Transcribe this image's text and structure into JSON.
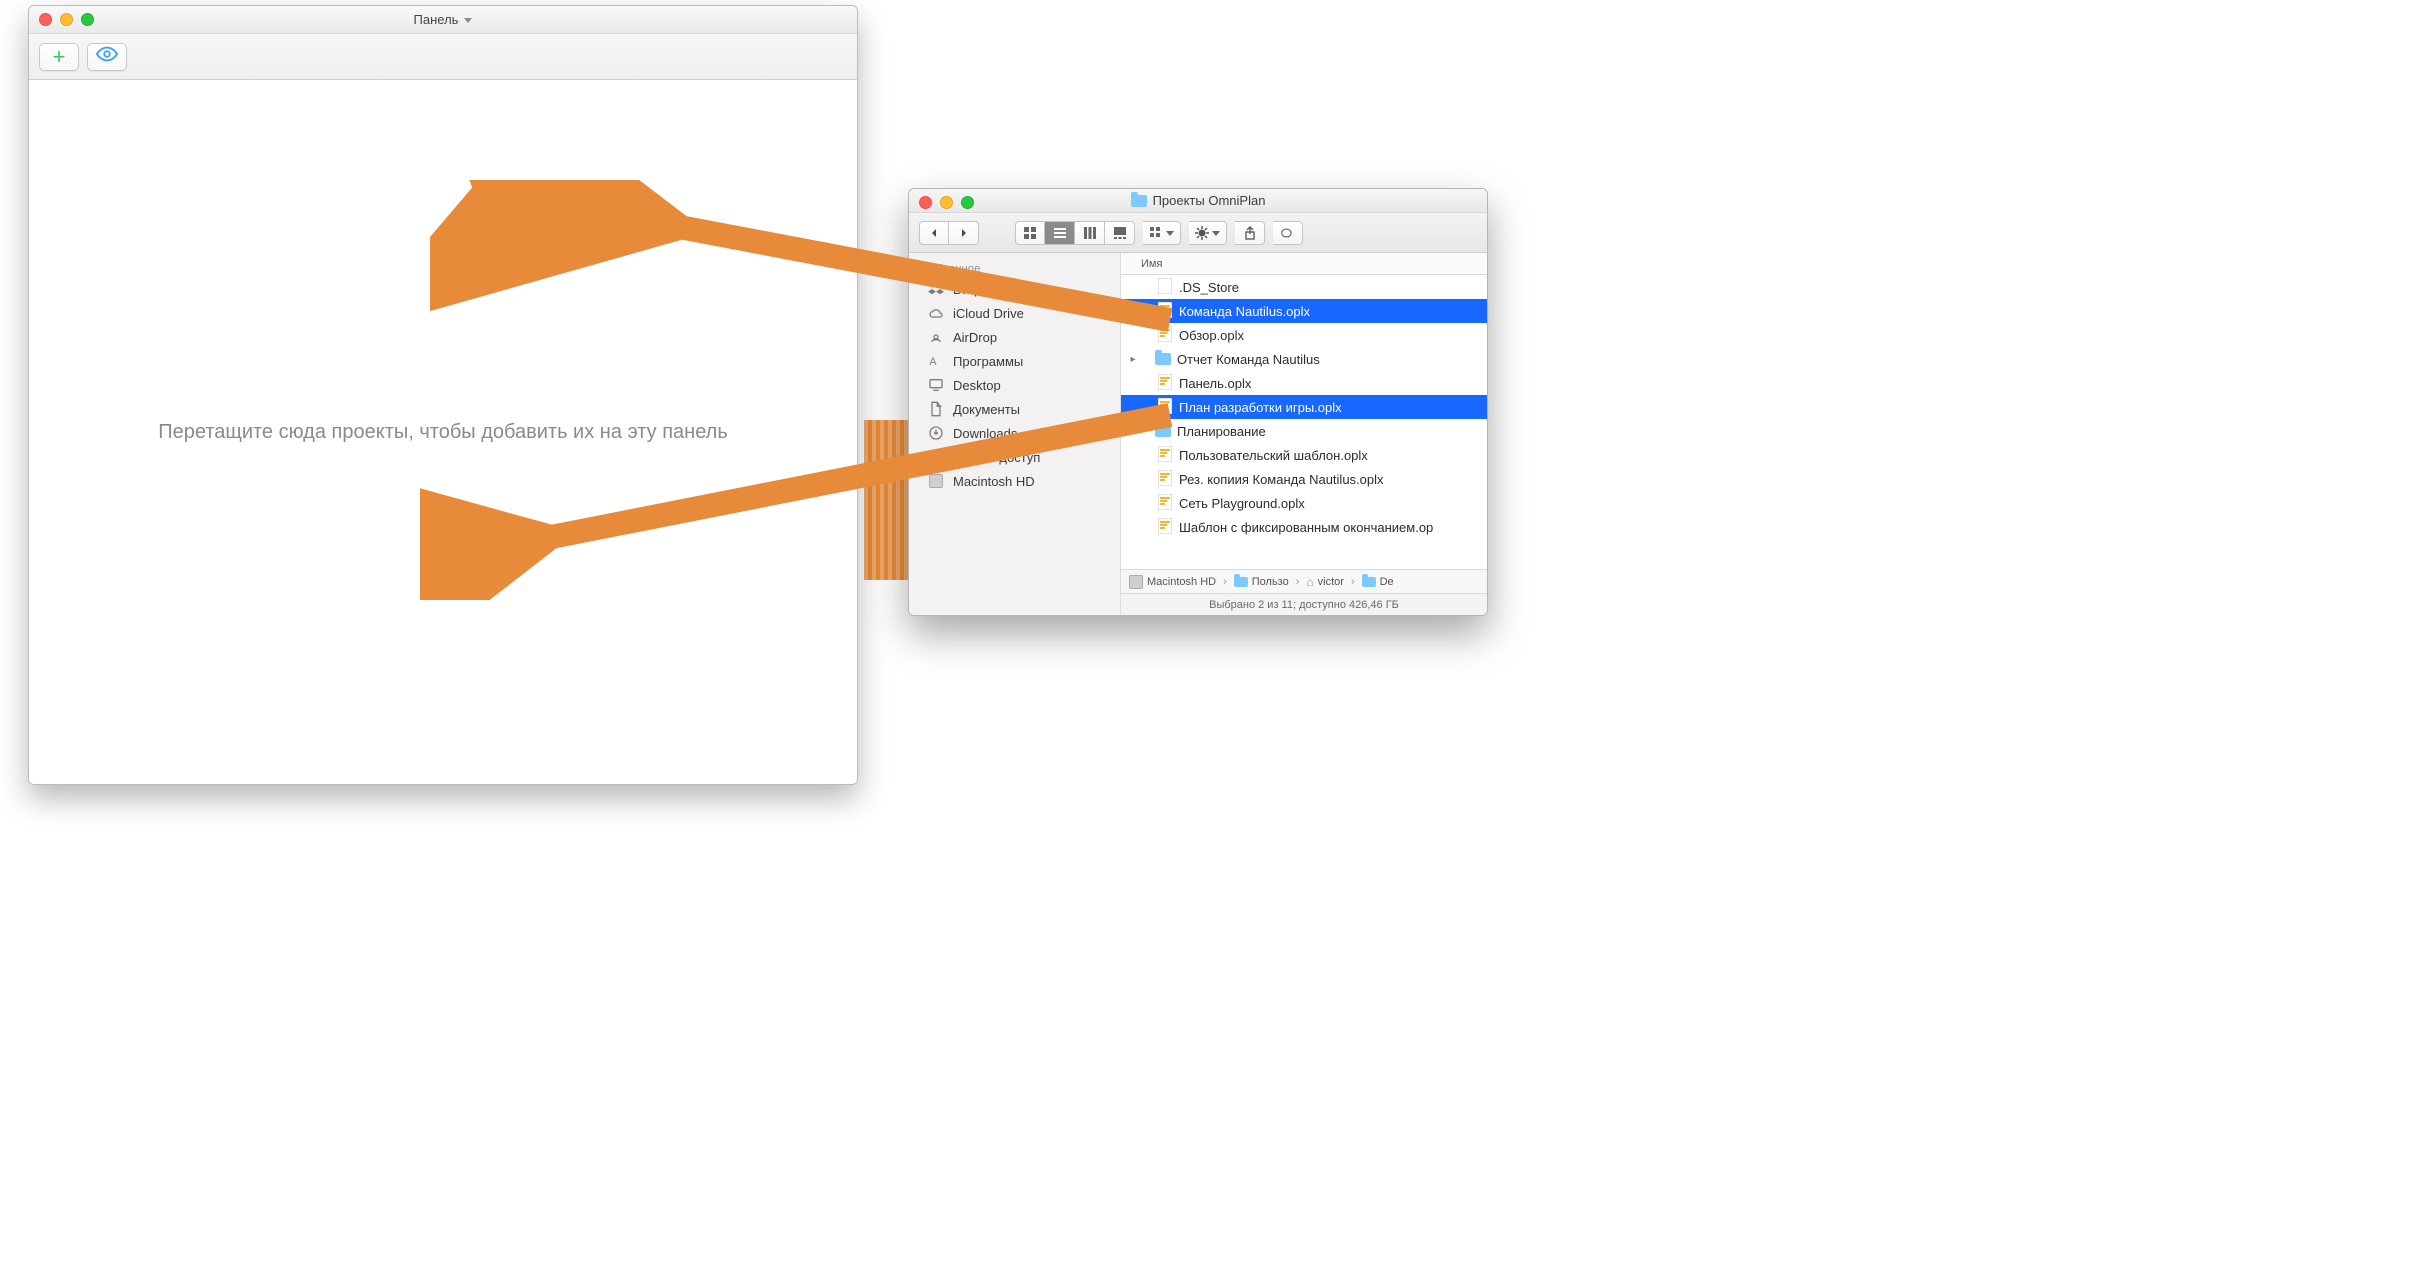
{
  "panel": {
    "title": "Панель",
    "drop_message": "Перетащите сюда проекты, чтобы добавить их на эту панель"
  },
  "finder": {
    "title": "Проекты OmniPlan",
    "sidebar": {
      "section": "Избранное",
      "items": [
        {
          "label": "Dropbox",
          "icon": "dropbox"
        },
        {
          "label": "iCloud Drive",
          "icon": "cloud"
        },
        {
          "label": "AirDrop",
          "icon": "airdrop"
        },
        {
          "label": "Программы",
          "icon": "apps"
        },
        {
          "label": "Desktop",
          "icon": "desktop"
        },
        {
          "label": "Документы",
          "icon": "documents"
        },
        {
          "label": "Downloads",
          "icon": "downloads"
        },
        {
          "label": "Общий доступ",
          "icon": "shared"
        },
        {
          "label": "Macintosh HD",
          "icon": "hd"
        }
      ]
    },
    "column_header": "Имя",
    "files": [
      {
        "name": ".DS_Store",
        "type": "file-generic",
        "selected": false,
        "indent": 1
      },
      {
        "name": "Команда Nautilus.oplx",
        "type": "oplx",
        "selected": true,
        "indent": 1
      },
      {
        "name": "Обзор.oplx",
        "type": "oplx",
        "selected": false,
        "indent": 1
      },
      {
        "name": "Отчет Команда Nautilus",
        "type": "folder",
        "selected": false,
        "indent": 0,
        "disclosure": true
      },
      {
        "name": "Панель.oplx",
        "type": "oplx",
        "selected": false,
        "indent": 1
      },
      {
        "name": "План разработки игры.oplx",
        "type": "oplx",
        "selected": true,
        "indent": 1
      },
      {
        "name": "Планирование",
        "type": "folder",
        "selected": false,
        "indent": 0,
        "disclosure": true
      },
      {
        "name": "Пользовательский шаблон.oplx",
        "type": "oplx",
        "selected": false,
        "indent": 1
      },
      {
        "name": "Рез. копиия Команда Nautilus.oplx",
        "type": "oplx",
        "selected": false,
        "indent": 1
      },
      {
        "name": "Сеть Playground.oplx",
        "type": "oplx",
        "selected": false,
        "indent": 1
      },
      {
        "name": "Шаблон с фиксированным окончанием.op",
        "type": "oplx",
        "selected": false,
        "indent": 1
      }
    ],
    "path": {
      "p0": "Macintosh HD",
      "p1": "Пользо",
      "p2": "victor",
      "p3": "De"
    },
    "status": "Выбрано 2 из 11; доступно 426,46 ГБ"
  },
  "colors": {
    "arrow": "#e78b3a",
    "selection": "#1867ff"
  }
}
